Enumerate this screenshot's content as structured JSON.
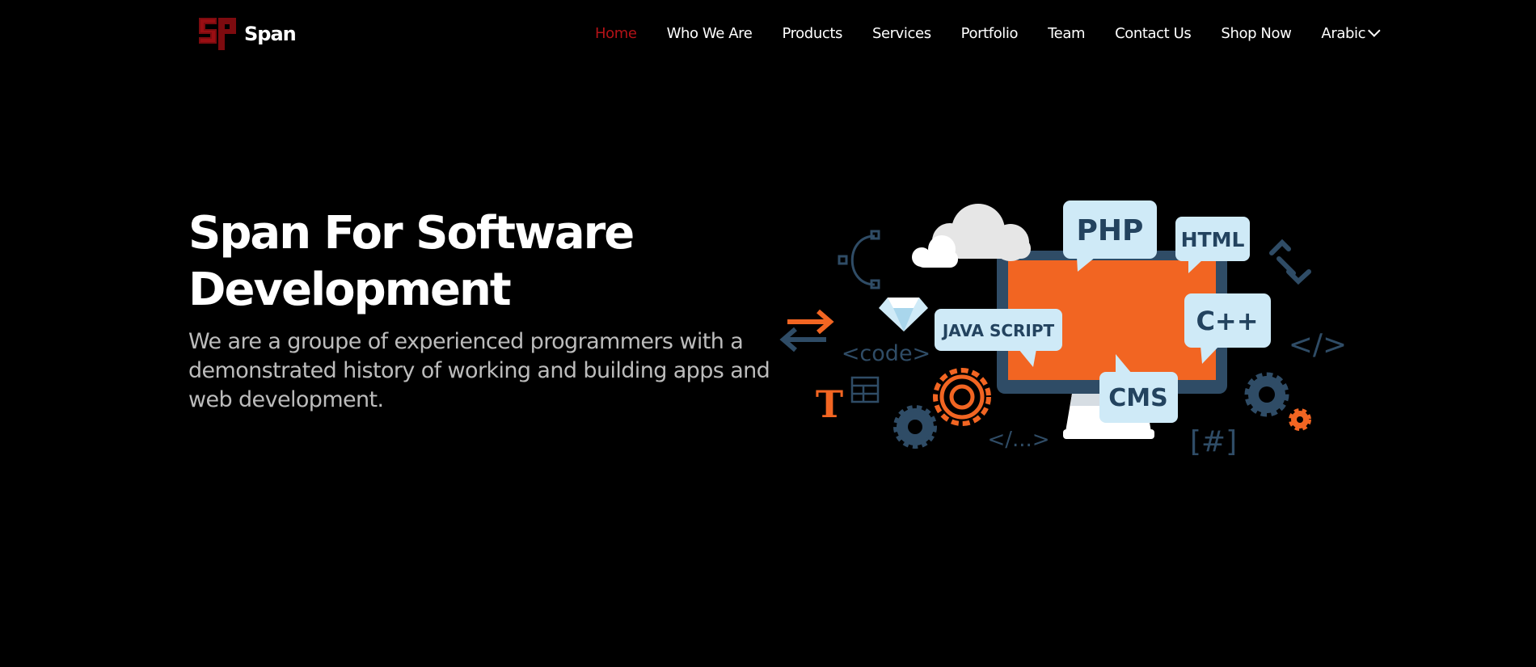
{
  "brand": {
    "name": "Span",
    "logo_icon": "span-logo-icon",
    "logo_color": "#b31217"
  },
  "nav": {
    "items": [
      {
        "label": "Home",
        "active": true
      },
      {
        "label": "Who We Are"
      },
      {
        "label": "Products"
      },
      {
        "label": "Services"
      },
      {
        "label": "Portfolio"
      },
      {
        "label": "Team"
      },
      {
        "label": "Contact Us"
      },
      {
        "label": "Shop Now"
      }
    ],
    "language": {
      "label": "Arabic",
      "icon": "chevron-down-icon"
    },
    "active_color": "#b31217"
  },
  "hero": {
    "title": "Span For Software Development",
    "subtitle": "We are a groupe of experienced programmers with a demonstrated history of working and building apps and web development."
  },
  "illustration": {
    "bubbles": [
      "PHP",
      "HTML",
      "JAVA SCRIPT",
      "C++",
      "CMS"
    ],
    "code_labels": [
      "<code>",
      "</...>",
      "[#]",
      "</>",
      "T"
    ],
    "icons": [
      "cloud-icon",
      "gem-icon",
      "swap-arrows-icon",
      "bezier-icon",
      "chain-icon",
      "gear-icon",
      "table-icon"
    ],
    "colors": {
      "screen": "#f26522",
      "frame": "#2f4c66",
      "bubble": "#cfeaf7",
      "bubble_text": "#23435f"
    }
  }
}
